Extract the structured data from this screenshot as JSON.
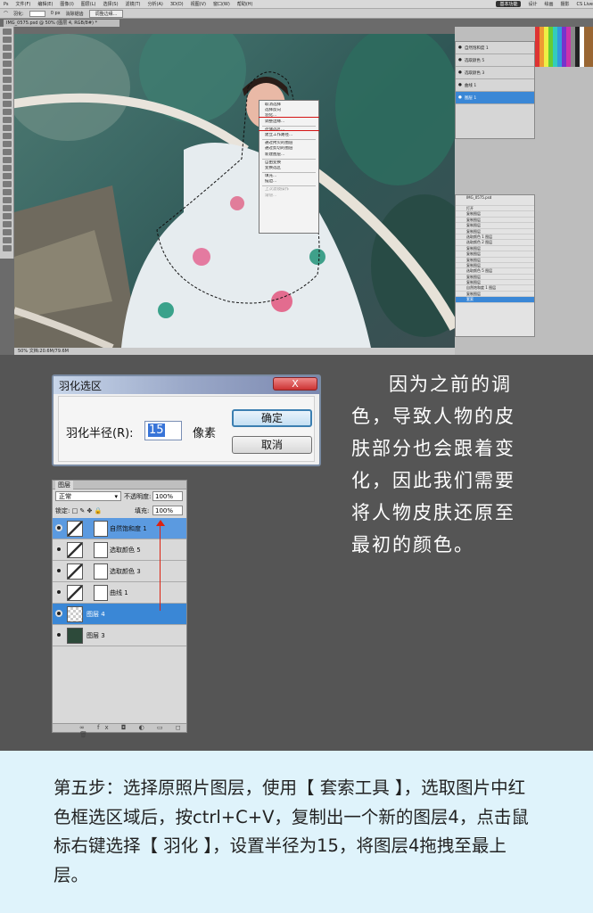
{
  "ps": {
    "menu": [
      "文件(F)",
      "编辑(E)",
      "图像(I)",
      "图层(L)",
      "选择(S)",
      "滤镜(T)",
      "分析(A)",
      "3D(D)",
      "视图(V)",
      "窗口(W)",
      "帮助(H)"
    ],
    "menu_right_buttons": [
      "基本功能",
      "设计",
      "绘画",
      "摄影"
    ],
    "cs_live": "CS Live",
    "opt_feather_label": "羽化:",
    "opt_feather_value": "0 px",
    "opt_antialias": "消除锯齿",
    "opt_refine": "调整边缘...",
    "doc_tab": "IMG_0575.psd @ 50% (图层 4, RGB/8#) *",
    "status": "50%    文档:20.6M/79.6M",
    "context_menu": [
      {
        "label": "取消选择",
        "dim": false
      },
      {
        "label": "选择反向",
        "dim": false
      },
      {
        "label": "羽化...",
        "dim": false
      },
      {
        "label": "调整边缘...",
        "dim": false
      },
      {
        "sep": true
      },
      {
        "label": "存储选区...",
        "dim": false
      },
      {
        "label": "建立工作路径...",
        "dim": false
      },
      {
        "sep": true
      },
      {
        "label": "通过拷贝的图层",
        "dim": false
      },
      {
        "label": "通过剪切的图层",
        "dim": false
      },
      {
        "label": "新建图层...",
        "dim": false
      },
      {
        "sep": true
      },
      {
        "label": "自由变换",
        "dim": false
      },
      {
        "label": "变换选区",
        "dim": false
      },
      {
        "sep": true
      },
      {
        "label": "填充...",
        "dim": false
      },
      {
        "label": "描边...",
        "dim": false
      },
      {
        "sep": true
      },
      {
        "label": "上次滤镜操作",
        "dim": true
      },
      {
        "label": "渐隐...",
        "dim": true
      }
    ],
    "mini_layers": [
      "自然饱和度 1",
      "选取颜色 5",
      "选取颜色 3",
      "曲线 1",
      "图层 1"
    ],
    "mini_layers_selected": 4,
    "history_doc": "IMG_0575.psd",
    "history": [
      "打开",
      "复制图层",
      "复制图层",
      "复制图层",
      "复制图层",
      "选取颜色 1 图层",
      "选取颜色 2 图层",
      "复制图层",
      "复制图层",
      "复制图层",
      "复制图层",
      "选取颜色 5 图层",
      "复制图层",
      "复制图层",
      "自然饱和度 1 图层",
      "复制图层",
      "套索"
    ],
    "history_selected": 16
  },
  "dialog": {
    "title": "羽化选区",
    "close": "X",
    "radius_label": "羽化半径(R):",
    "radius_value": "15",
    "unit": "像素",
    "ok": "确定",
    "cancel": "取消"
  },
  "explain": [
    "因为之前的调",
    "色，导致人物的皮",
    "肤部分也会跟着变",
    "化，因此我们需要",
    "将人物皮肤还原至",
    "最初的颜色。"
  ],
  "layers": {
    "tab": "图层",
    "blend": "正常",
    "opacity_label": "不透明度:",
    "opacity": "100%",
    "lock_label": "锁定:",
    "fill_label": "填充:",
    "fill": "100%",
    "rows": [
      {
        "name": "自然饱和度 1",
        "type": "adj"
      },
      {
        "name": "选取颜色 5",
        "type": "adj"
      },
      {
        "name": "选取颜色 3",
        "type": "adj"
      },
      {
        "name": "曲线 1",
        "type": "adj"
      },
      {
        "name": "图层 4",
        "type": "img"
      },
      {
        "name": "图层 3",
        "type": "img"
      }
    ]
  },
  "step": "第五步：选择原照片图层，使用【 套索工具 】，选取图片中红色框选区域后，按ctrl+C+V，复制出一个新的图层4，点击鼠标右键选择【 羽化 】，设置半径为15，将图层4拖拽至最上层。"
}
